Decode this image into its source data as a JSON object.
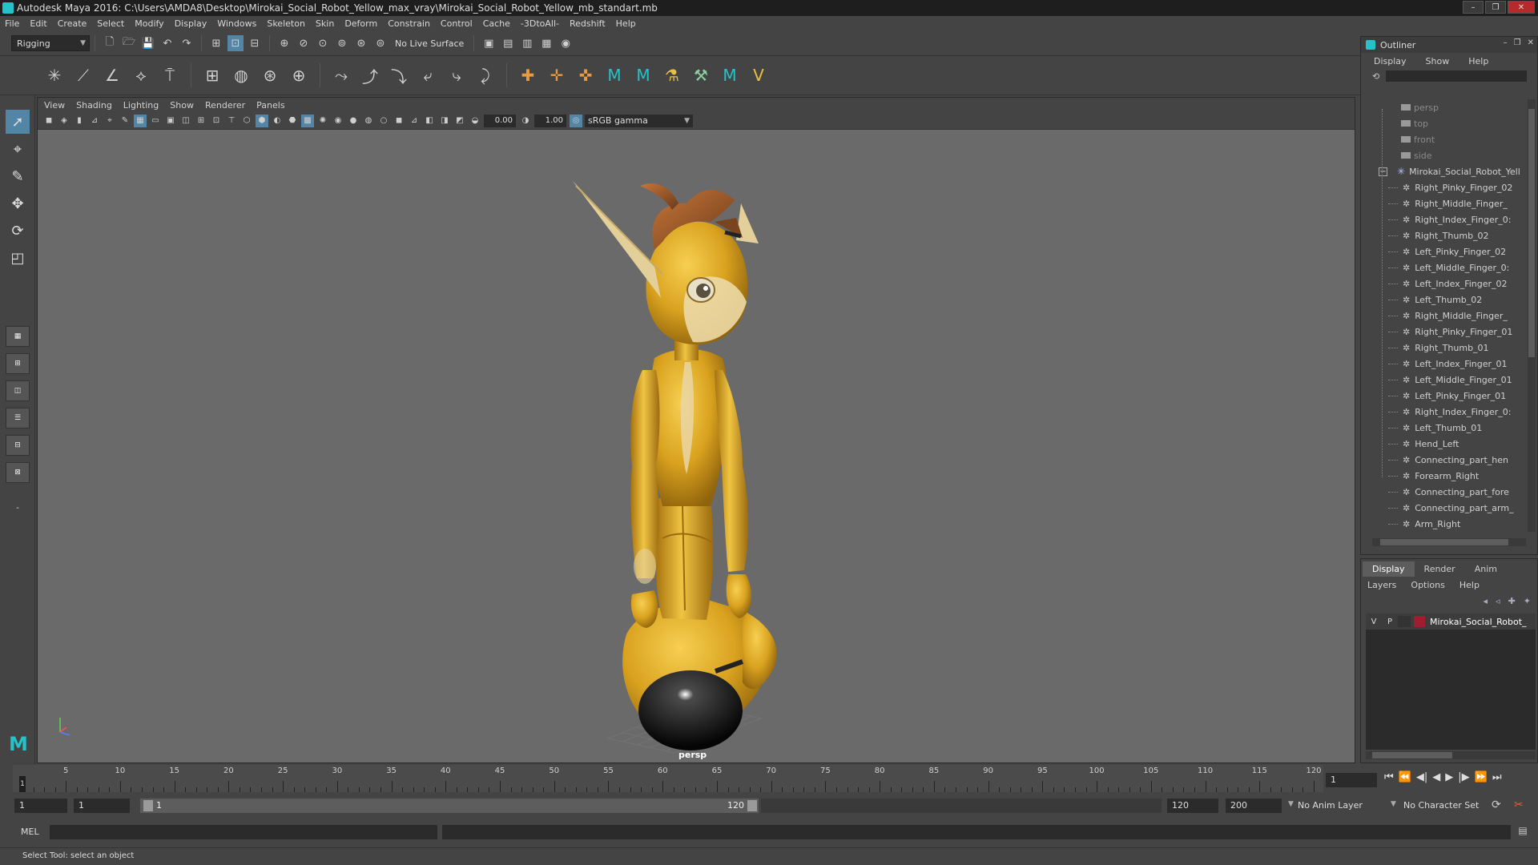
{
  "window": {
    "title": "Autodesk Maya 2016: C:\\Users\\AMDA8\\Desktop\\Mirokai_Social_Robot_Yellow_max_vray\\Mirokai_Social_Robot_Yellow_mb_standart.mb",
    "controls": [
      "–",
      "❐",
      "✕"
    ]
  },
  "menubar": [
    "File",
    "Edit",
    "Create",
    "Select",
    "Modify",
    "Display",
    "Windows",
    "Skeleton",
    "Skin",
    "Deform",
    "Constrain",
    "Control",
    "Cache",
    "-3DtoAll-",
    "Redshift",
    "Help"
  ],
  "statusline": {
    "mode": "Rigging",
    "live_surface": "No Live Surface"
  },
  "viewport": {
    "menu": [
      "View",
      "Shading",
      "Lighting",
      "Show",
      "Renderer",
      "Panels"
    ],
    "exposure": "0.00",
    "gamma_value": "1.00",
    "color_space": "sRGB gamma",
    "camera": "persp"
  },
  "outliner": {
    "title": "Outliner",
    "menu": [
      "Display",
      "Show",
      "Help"
    ],
    "cameras": [
      "persp",
      "top",
      "front",
      "side"
    ],
    "root": "Mirokai_Social_Robot_Yell",
    "items": [
      "Right_Pinky_Finger_02",
      "Right_Middle_Finger_",
      "Right_Index_Finger_0:",
      "Right_Thumb_02",
      "Left_Pinky_Finger_02",
      "Left_Middle_Finger_0:",
      "Left_Index_Finger_02",
      "Left_Thumb_02",
      "Right_Middle_Finger_",
      "Right_Pinky_Finger_01",
      "Right_Thumb_01",
      "Left_Index_Finger_01",
      "Left_Middle_Finger_01",
      "Left_Pinky_Finger_01",
      "Right_Index_Finger_0:",
      "Left_Thumb_01",
      "Hend_Left",
      "Connecting_part_hen",
      "Forearm_Right",
      "Connecting_part_fore",
      "Connecting_part_arm_",
      "Arm_Right"
    ]
  },
  "layers": {
    "tabs": [
      "Display",
      "Render",
      "Anim"
    ],
    "menu": [
      "Layers",
      "Options",
      "Help"
    ],
    "layer": {
      "v": "V",
      "p": "P",
      "name": "Mirokai_Social_Robot_",
      "color": "#a01c30"
    }
  },
  "timeline": {
    "ticks": [
      "5",
      "10",
      "15",
      "20",
      "25",
      "30",
      "35",
      "40",
      "45",
      "50",
      "55",
      "60",
      "65",
      "70",
      "75",
      "80",
      "85",
      "90",
      "95",
      "100",
      "105",
      "110",
      "115",
      "120"
    ],
    "cursor_frame": "1",
    "current_frame": "1",
    "start_frame": "1",
    "range_start": "1",
    "range_handle_start": "1",
    "range_handle_end": "120",
    "end_frame": "120",
    "max_frame": "200",
    "anim_layer": "No Anim Layer",
    "character_set": "No Character Set"
  },
  "command": {
    "language": "MEL"
  },
  "help_line": "Select Tool: select an object",
  "colors": {
    "accent": "#5285a6",
    "maya_teal": "#25c2c9",
    "robot_yellow": "#d9a21f"
  }
}
